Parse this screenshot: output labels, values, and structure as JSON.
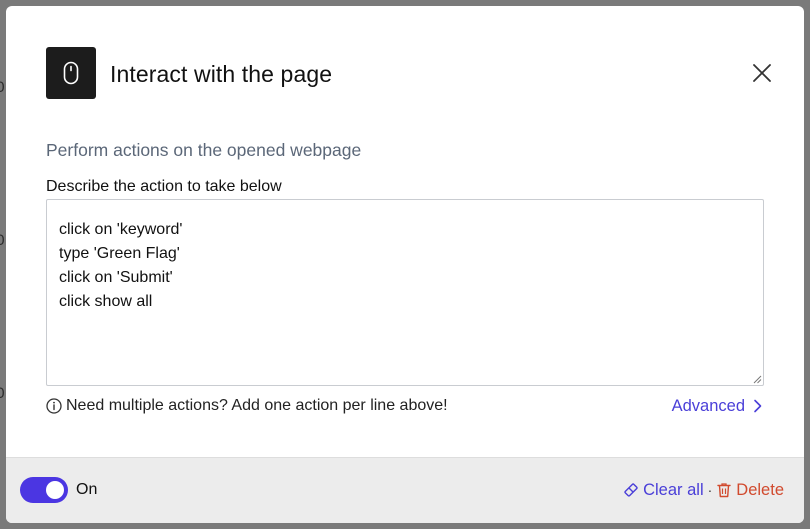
{
  "dialog": {
    "title": "Interact with the page",
    "title_icon": "mouse-icon",
    "close_icon": "close-icon",
    "subtitle": "Perform actions on the opened webpage",
    "field_label": "Describe the action to take below",
    "actions_text": "click on 'keyword'\ntype 'Green Flag'\nclick on 'Submit'\nclick show all",
    "hint": "Need multiple actions? Add one action per line above!",
    "hint_icon": "info-icon",
    "advanced_label": "Advanced",
    "advanced_icon": "chevron-right-icon"
  },
  "footer": {
    "toggle_label": "On",
    "toggle_on": true,
    "clear_all_label": "Clear all",
    "clear_all_icon": "eraser-icon",
    "separator": "·",
    "delete_label": "Delete",
    "delete_icon": "trash-icon"
  },
  "colors": {
    "accent": "#4b36e2",
    "link": "#4a3fd8",
    "danger": "#d14a2e",
    "subtitle": "#5b6778"
  }
}
